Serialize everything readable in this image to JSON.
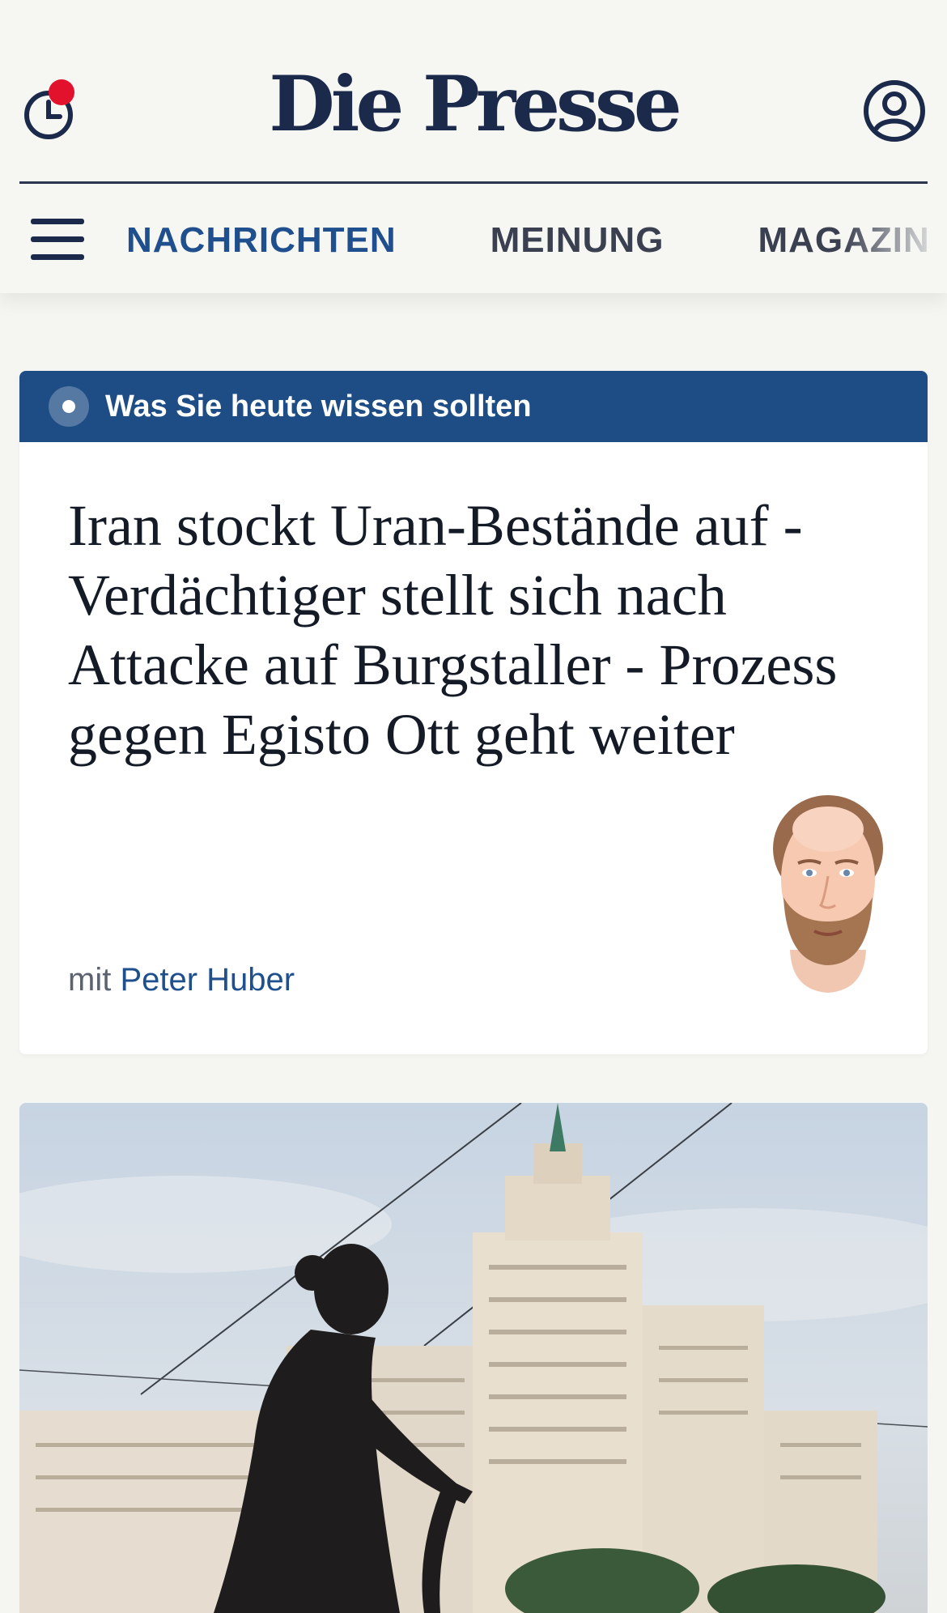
{
  "header": {
    "logo": "Die Presse",
    "history_icon": "history-clock-icon",
    "account_icon": "user-account-icon",
    "notification_color": "#e3122c"
  },
  "nav": {
    "menu_icon": "hamburger-menu-icon",
    "items": [
      {
        "label": "NACHRICHTEN",
        "active": true
      },
      {
        "label": "MEINUNG",
        "active": false
      },
      {
        "label": "MAGAZIN",
        "active": false
      }
    ],
    "active_color": "#1f4f8c"
  },
  "briefing_card": {
    "banner_label": "Was Sie heute wissen sollten",
    "banner_color": "#1e4d86",
    "headline": "Iran stockt Uran-Bestände auf - Verdächtiger stellt sich nach Attacke auf Burgstaller - Prozess gegen Egisto Ott geht weiter",
    "byline_prefix": "mit",
    "author": "Peter Huber"
  }
}
